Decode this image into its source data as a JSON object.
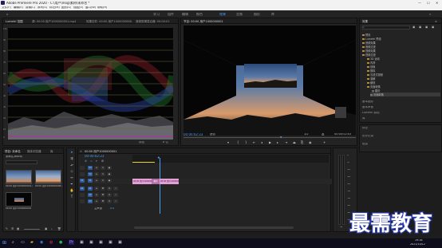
{
  "titlebar": {
    "title": "Adobe Premiere Pro 2020 - C:\\用户\\Vlog\\素材\\未命名 *"
  },
  "menu": [
    "文件(F)",
    "编辑(E)",
    "剪辑(C)",
    "序列(S)",
    "标记(M)",
    "图形(G)",
    "视图(V)",
    "窗口(W)",
    "帮助(H)"
  ],
  "workspaces": {
    "items": [
      "学习",
      "组件",
      "编辑",
      "颜色",
      "效果",
      "音频",
      "图形",
      "库"
    ],
    "active": "效果"
  },
  "scope": {
    "tabs": [
      "Lumetri 范围",
      "源: 00:00 用户1000000001.mp4",
      "效果控件: 00:00 用户1000000008.mp4",
      "音频剪辑混合器: 00:00:01"
    ],
    "ticks": [
      "100",
      "90",
      "80",
      "70",
      "60",
      "50",
      "40",
      "30",
      "20",
      "10",
      "0"
    ],
    "bottom_label": "8 位",
    "bottom_right": "按钮"
  },
  "program": {
    "tab": "节目: 00:00 用户1000000001",
    "timecode": "00:00:02:23",
    "fit": "适合",
    "zoom": "1/2",
    "duration": "00:00:02:03"
  },
  "effects": {
    "title": "效果",
    "tree": [
      {
        "label": "预设",
        "indent": 0
      },
      {
        "label": "Lumetri 预设",
        "indent": 0
      },
      {
        "label": "音频效果",
        "indent": 0
      },
      {
        "label": "音频过渡",
        "indent": 0
      },
      {
        "label": "视频效果",
        "indent": 0
      },
      {
        "label": "视频过渡",
        "indent": 0
      },
      {
        "label": "3D 运动",
        "indent": 1
      },
      {
        "label": "内滑",
        "indent": 1
      },
      {
        "label": "划像",
        "indent": 1
      },
      {
        "label": "擦除",
        "indent": 1
      },
      {
        "label": "沉浸式视频",
        "indent": 1
      },
      {
        "label": "溶解",
        "indent": 1
      },
      {
        "label": "缩放",
        "indent": 1
      },
      {
        "label": "页面剥落",
        "indent": 1
      },
      {
        "label": "翻页",
        "indent": 2
      },
      {
        "label": "页面剥落",
        "indent": 2
      }
    ],
    "selected_index": 15,
    "panels": [
      "基本图形",
      "基本声音",
      "Lumetri 颜色",
      "库",
      "标记",
      "历史记录",
      "信息"
    ]
  },
  "project": {
    "tabs": [
      "项目: 未命名",
      "媒体浏览器",
      "库"
    ],
    "file": "未命名.prproj",
    "search_placeholder": "",
    "items": [
      {
        "label": "00:00 用户1000000001.mp4"
      },
      {
        "label": "00:00 用户1000000008.mp4"
      },
      {
        "label": "00:00 用户1000000001"
      }
    ]
  },
  "timeline": {
    "tab": "00:00 用户1000000001",
    "timecode": "00:00:02:23",
    "tracks": [
      "V3",
      "V2",
      "V1",
      "A1",
      "A2",
      "A3"
    ],
    "master": "主声道",
    "master_val": "0.0",
    "clip1": "00:00 用户1000000001.mp4",
    "clip2": "00:00 用户1000000008.mp4",
    "transition": "翻页",
    "meter_labels": [
      "0",
      "-6",
      "-12",
      "-18",
      "-24",
      "-30",
      "-36",
      "-42",
      "-48",
      "-54"
    ],
    "meter_unit": "dB"
  },
  "watermark": "最需教育",
  "taskbar": {
    "time": "19:16",
    "date": "2021/10/12"
  },
  "colors": {
    "accent": "#4f9df0",
    "clip_pink": "#e3a0d6",
    "folder": "#b08b3a"
  }
}
